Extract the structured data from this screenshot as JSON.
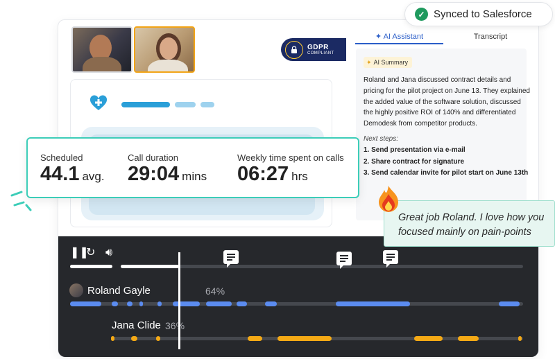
{
  "gdpr": {
    "title": "GDPR",
    "subtitle": "COMPLIANT"
  },
  "sync": {
    "label": "Synced to Salesforce"
  },
  "panel": {
    "tabs": [
      {
        "label": "AI Assistant"
      },
      {
        "label": "Transcript"
      }
    ],
    "badge": "AI Summary",
    "summary": "Roland and Jana discussed contract details and pricing for the pilot project on June 13. They explained the added value of the software solution, discussed the highly positive ROI of 140% and differentiated Demodesk from competitor products.",
    "next_steps_label": "Next steps:",
    "steps": [
      "1. Send presentation via e-mail",
      "2. Share contract for signature",
      "3. Send calendar invite for pilot start on June 13th"
    ]
  },
  "stats": [
    {
      "label": "Scheduled",
      "value": "44.1",
      "unit": "avg."
    },
    {
      "label": "Call duration",
      "value": "29:04",
      "unit": "mins"
    },
    {
      "label": "Weekly time spent on calls",
      "value": "06:27",
      "unit": "hrs"
    }
  ],
  "feedback": {
    "text": "Great job Roland. I love how you focused mainly on pain-points"
  },
  "player": {
    "speakers": [
      {
        "name": "Roland Gayle",
        "percent": "64%",
        "color": "#5b8cf0"
      },
      {
        "name": "Jana Clide",
        "percent": "36%",
        "color": "#f4a915"
      }
    ]
  },
  "colors": {
    "accent": "#2b5ec8",
    "stats_border": "#3ccdb8",
    "success": "#1f9a5e",
    "gdpr_badge": "#1b2a63"
  }
}
